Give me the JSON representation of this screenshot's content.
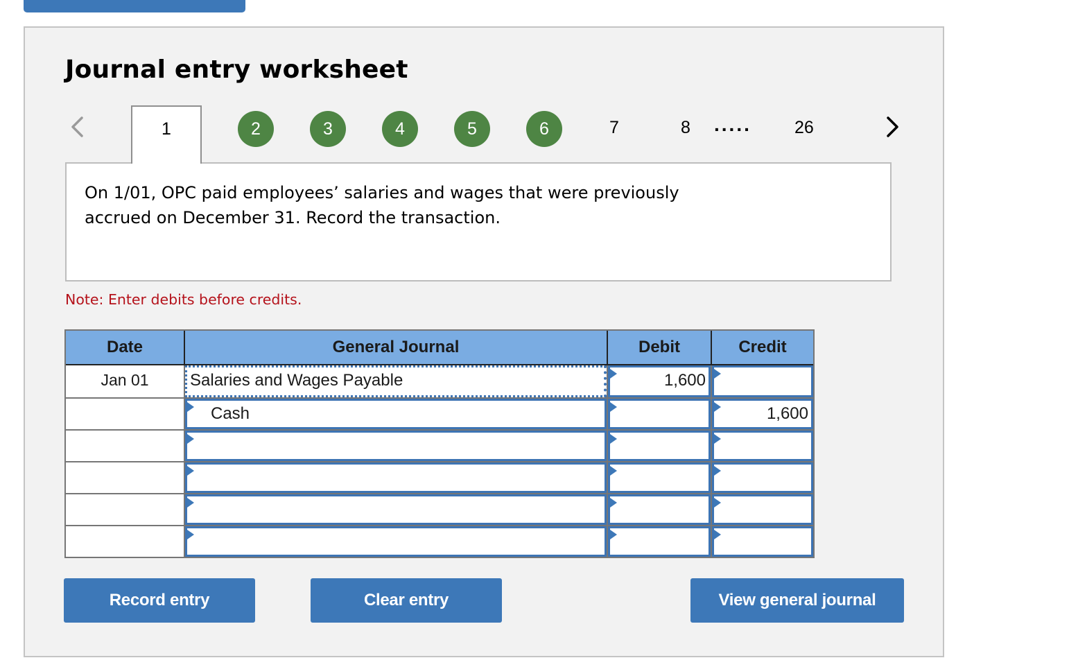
{
  "title": "Journal entry worksheet",
  "pager": {
    "prev_icon": "chevron-left-icon",
    "next_icon": "chevron-right-icon",
    "current": "1",
    "completed": [
      "2",
      "3",
      "4",
      "5",
      "6"
    ],
    "pending": [
      "7",
      "8"
    ],
    "ellipsis": ".....",
    "last": "26",
    "completed_color": "#4e8544"
  },
  "question": {
    "text": "On 1/01, OPC paid employees’ salaries and wages that were previously accrued on December 31. Record the transaction."
  },
  "note": "Note: Enter debits before credits.",
  "journal": {
    "headers": {
      "date": "Date",
      "account": "General Journal",
      "debit": "Debit",
      "credit": "Credit"
    },
    "rows": [
      {
        "date": "Jan 01",
        "account": "Salaries and Wages Payable",
        "debit": "1,600",
        "credit": ""
      },
      {
        "date": "",
        "account": "Cash",
        "debit": "",
        "credit": "1,600"
      },
      {
        "date": "",
        "account": "",
        "debit": "",
        "credit": ""
      },
      {
        "date": "",
        "account": "",
        "debit": "",
        "credit": ""
      },
      {
        "date": "",
        "account": "",
        "debit": "",
        "credit": ""
      },
      {
        "date": "",
        "account": "",
        "debit": "",
        "credit": ""
      }
    ]
  },
  "buttons": {
    "record": "Record entry",
    "clear": "Clear entry",
    "view": "View general journal"
  },
  "colors": {
    "accent": "#3d78b8",
    "header_bg": "#7aace2",
    "note": "#b5121b"
  }
}
